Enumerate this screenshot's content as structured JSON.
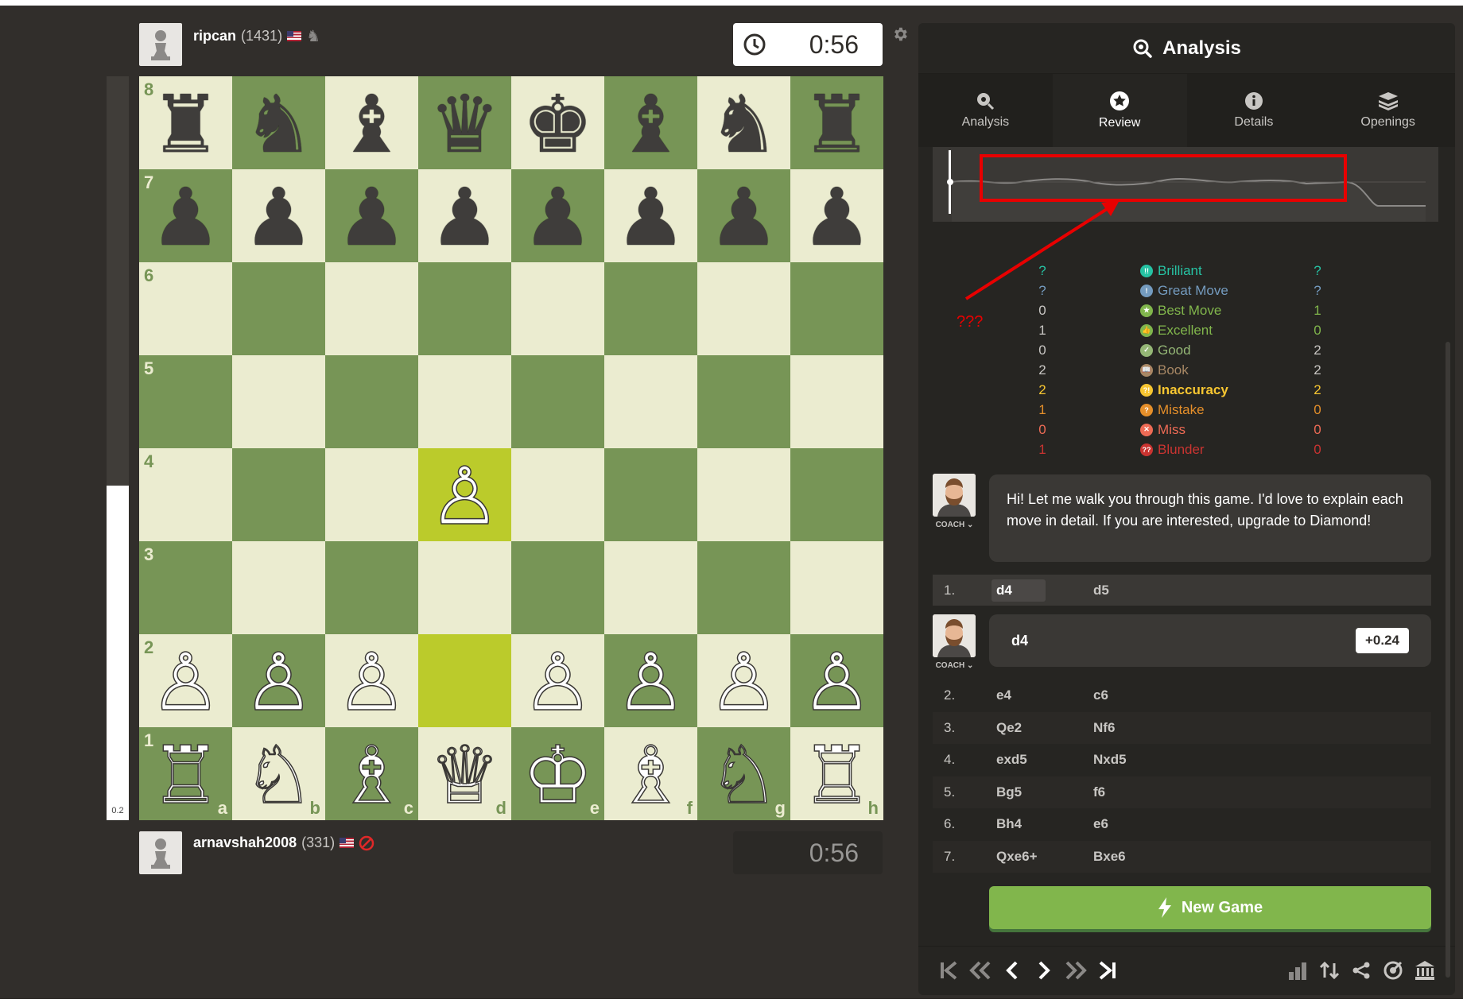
{
  "players": {
    "top": {
      "name": "ripcan",
      "rating": "(1431)",
      "clock": "0:56"
    },
    "bottom": {
      "name": "arnavshah2008",
      "rating": "(331)",
      "clock": "0:56"
    }
  },
  "eval_bar": {
    "score": "0.2",
    "white_fraction": 0.45
  },
  "board": {
    "files": [
      "a",
      "b",
      "c",
      "d",
      "e",
      "f",
      "g",
      "h"
    ],
    "ranks": [
      "8",
      "7",
      "6",
      "5",
      "4",
      "3",
      "2",
      "1"
    ],
    "position": [
      [
        "♜",
        "♞",
        "♝",
        "♛",
        "♚",
        "♝",
        "♞",
        "♜"
      ],
      [
        "♟",
        "♟",
        "♟",
        "♟",
        "♟",
        "♟",
        "♟",
        "♟"
      ],
      [
        "",
        "",
        "",
        "",
        "",
        "",
        "",
        ""
      ],
      [
        "",
        "",
        "",
        "",
        "",
        "",
        "",
        ""
      ],
      [
        "",
        "",
        "",
        "♙",
        "",
        "",
        "",
        ""
      ],
      [
        "",
        "",
        "",
        "",
        "",
        "",
        "",
        ""
      ],
      [
        "♙",
        "♙",
        "♙",
        "",
        "♙",
        "♙",
        "♙",
        "♙"
      ],
      [
        "♖",
        "♘",
        "♗",
        "♕",
        "♔",
        "♗",
        "♘",
        "♖"
      ]
    ],
    "highlighted": [
      "d4",
      "d2"
    ]
  },
  "panel": {
    "title": "Analysis",
    "tabs": [
      {
        "label": "Analysis",
        "icon": "analysis-icon"
      },
      {
        "label": "Review",
        "icon": "star-icon",
        "active": true
      },
      {
        "label": "Details",
        "icon": "info-icon"
      },
      {
        "label": "Openings",
        "icon": "book-icon"
      }
    ]
  },
  "annotation": {
    "text": "???",
    "color": "#e80000"
  },
  "classification": [
    {
      "label": "Brilliant",
      "white": "?",
      "black": "?",
      "color": "#26c2a3",
      "icon": "!!"
    },
    {
      "label": "Great Move",
      "white": "?",
      "black": "?",
      "color": "#749bbf",
      "icon": "!"
    },
    {
      "label": "Best Move",
      "white": "0",
      "black": "1",
      "color": "#81b64c",
      "icon": "★"
    },
    {
      "label": "Excellent",
      "white": "1",
      "black": "0",
      "color": "#81b64c",
      "icon": "👍"
    },
    {
      "label": "Good",
      "white": "0",
      "black": "2",
      "color": "#95b776",
      "icon": "✓"
    },
    {
      "label": "Book",
      "white": "2",
      "black": "2",
      "color": "#a88865",
      "icon": "📖"
    },
    {
      "label": "Inaccuracy",
      "white": "2",
      "black": "2",
      "color": "#f7c631",
      "icon": "?!"
    },
    {
      "label": "Mistake",
      "white": "1",
      "black": "0",
      "color": "#e58f2a",
      "icon": "?"
    },
    {
      "label": "Miss",
      "white": "0",
      "black": "0",
      "color": "#ee6b55",
      "icon": "✕"
    },
    {
      "label": "Blunder",
      "white": "1",
      "black": "0",
      "color": "#ca3431",
      "icon": "??"
    }
  ],
  "coach": {
    "label": "COACH",
    "message": "Hi! Let me walk you through this game. I'd love to explain each move in detail. If you are interested, upgrade to Diamond!",
    "move_comment": "d4",
    "eval": "+0.24"
  },
  "moves": [
    {
      "num": "1.",
      "white": "d4",
      "black": "d5"
    },
    {
      "num": "2.",
      "white": "e4",
      "black": "c6"
    },
    {
      "num": "3.",
      "white": "Qe2",
      "black": "Nf6"
    },
    {
      "num": "4.",
      "white": "exd5",
      "black": "Nxd5"
    },
    {
      "num": "5.",
      "white": "Bg5",
      "black": "f6"
    },
    {
      "num": "6.",
      "white": "Bh4",
      "black": "e6"
    },
    {
      "num": "7.",
      "white": "Qxe6+",
      "black": "Bxe6"
    }
  ],
  "new_game_label": "New Game"
}
